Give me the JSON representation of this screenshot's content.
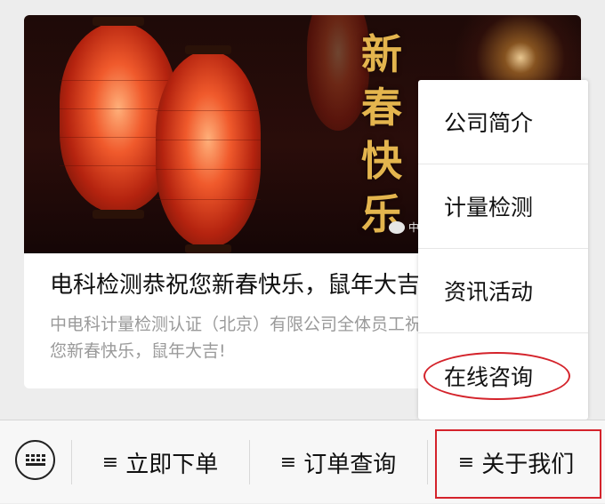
{
  "article": {
    "title": "电科检测恭祝您新春快乐，鼠年大吉",
    "desc_line1": "中电科计量检测认证（北京）有限公司全体员工祝",
    "desc_line2": "您新春快乐，鼠年大吉!",
    "banner_text": [
      "新",
      "春",
      "快",
      "乐"
    ],
    "banner_watermark": "中"
  },
  "popup_menu": {
    "items": [
      "公司简介",
      "计量检测",
      "资讯活动",
      "在线咨询"
    ]
  },
  "bottom_bar": {
    "tabs": [
      {
        "icon": "≡",
        "label": "立即下单"
      },
      {
        "icon": "≡",
        "label": "订单查询"
      },
      {
        "icon": "≡",
        "label": "关于我们"
      }
    ]
  },
  "colors": {
    "highlight": "#d4232b",
    "banner_text": "#e4b54e"
  }
}
